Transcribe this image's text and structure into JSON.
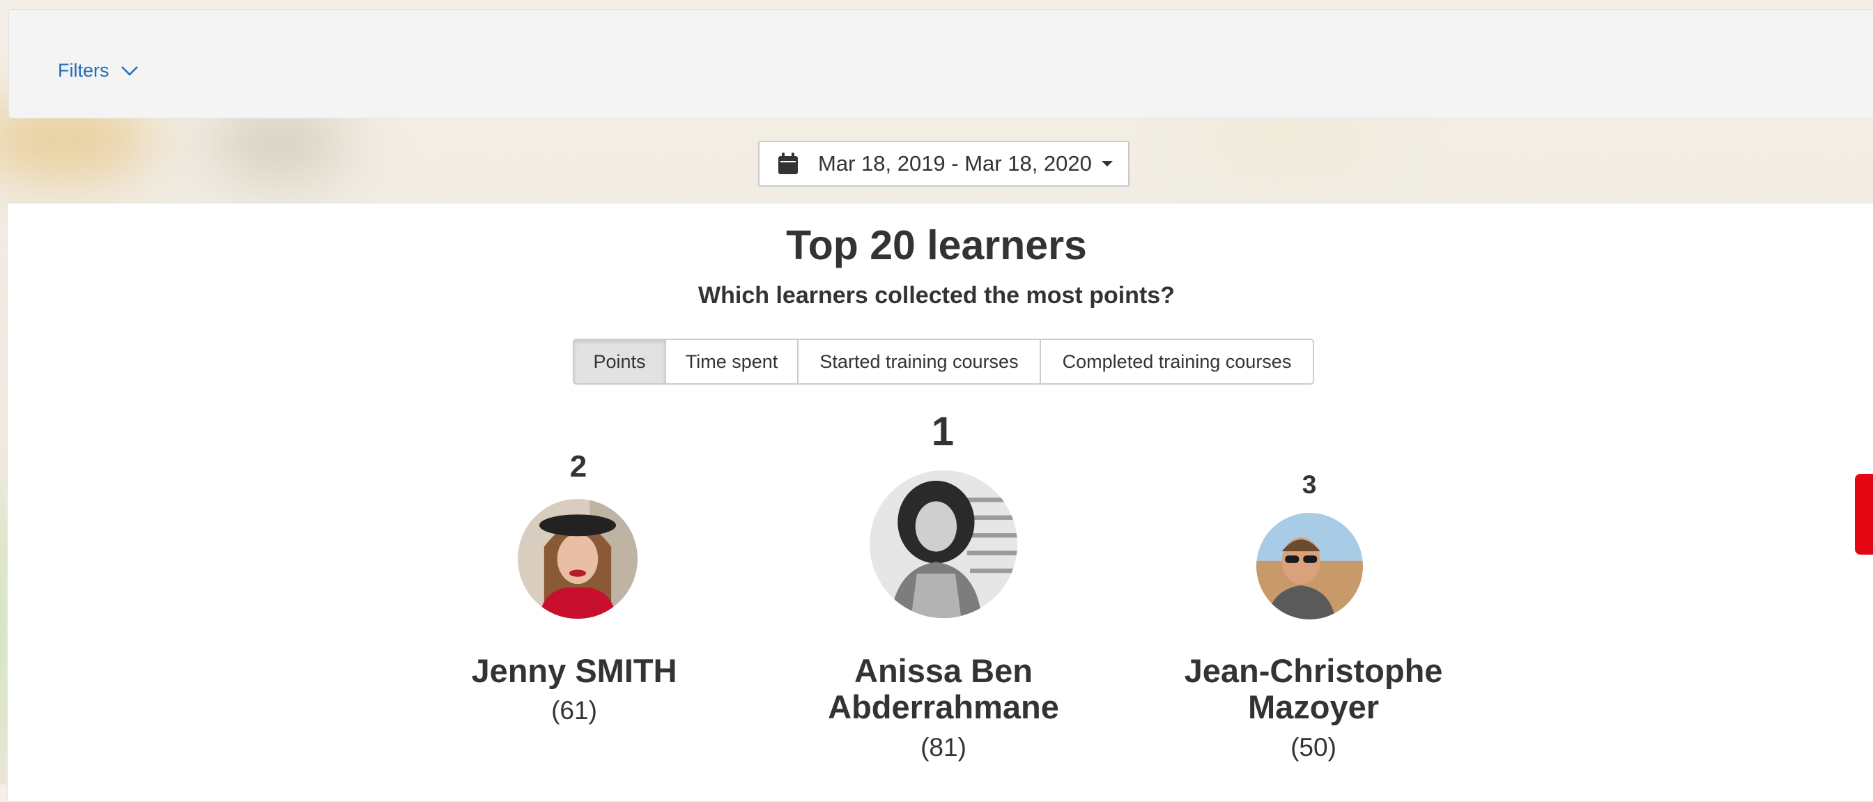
{
  "filters": {
    "label": "Filters"
  },
  "date_range": {
    "label": "Mar 18, 2019 - Mar 18, 2020"
  },
  "widget": {
    "title": "Top 20 learners",
    "subtitle": "Which learners collected the most points?",
    "tabs": [
      {
        "label": "Points",
        "active": true
      },
      {
        "label": "Time spent",
        "active": false
      },
      {
        "label": "Started training courses",
        "active": false
      },
      {
        "label": "Completed training courses",
        "active": false
      }
    ]
  },
  "podium": {
    "second": {
      "rank": "2",
      "name": "Jenny SMITH",
      "score": "(61)"
    },
    "first": {
      "rank": "1",
      "name_line1": "Anissa Ben",
      "name_line2": "Abderrahmane",
      "score": "(81)"
    },
    "third": {
      "rank": "3",
      "name_line1": "Jean-Christophe",
      "name_line2": "Mazoyer",
      "score": "(50)"
    }
  },
  "colors": {
    "link": "#1c6fb8",
    "accent": "#e30613",
    "text": "#333333"
  },
  "icons": {
    "filters_toggle": "chevron-down-icon",
    "date": "calendar-icon",
    "date_caret": "caret-down-icon"
  }
}
